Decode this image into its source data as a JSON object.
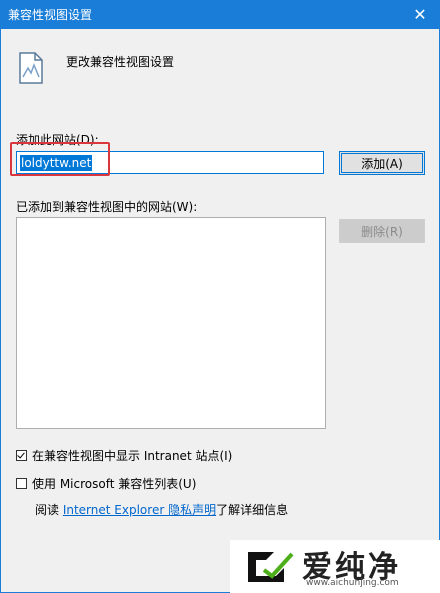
{
  "window": {
    "title": "兼容性视图设置",
    "close_glyph": "✕"
  },
  "header": {
    "text": "更改兼容性视图设置",
    "icon": "compat-document-icon"
  },
  "add_section": {
    "label": "添加此网站(D):",
    "input_value": "loldyttw.net",
    "add_button": "添加(A)"
  },
  "list_section": {
    "label": "已添加到兼容性视图中的网站(W):",
    "items": [],
    "delete_button": "删除(R)"
  },
  "options": [
    {
      "label": "在兼容性视图中显示 Intranet 站点(I)",
      "checked": true
    },
    {
      "label": "使用 Microsoft 兼容性列表(U)",
      "checked": false
    }
  ],
  "info": {
    "prefix": "阅读 ",
    "link": "Internet Explorer 隐私声明",
    "suffix": "了解详细信息"
  },
  "watermark": {
    "text": "爱纯净",
    "url": "www.aichunjing.com"
  },
  "colors": {
    "titlebar": "#1a7dd7",
    "accent": "#0078d7",
    "highlight": "#d9363e",
    "link": "#0066cc"
  }
}
